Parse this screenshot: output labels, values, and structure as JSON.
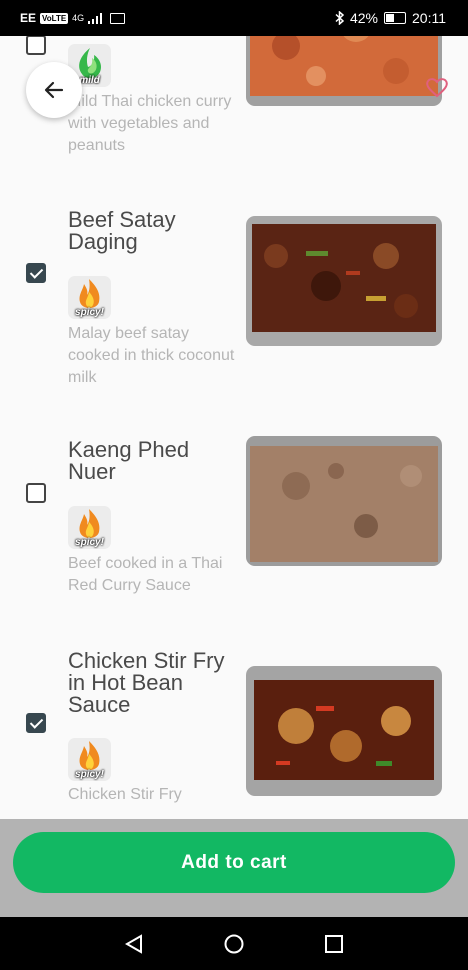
{
  "status_bar": {
    "carrier": "EE",
    "volte": "VoLTE",
    "network": "4G",
    "battery": "42%",
    "time": "20:11",
    "battery_level": 0.42
  },
  "items": [
    {
      "name": "",
      "checked": false,
      "badge_label": "mild",
      "badge_icon": "chili-mild-icon",
      "description": "Mild Thai chicken curry with vegetables and peanuts",
      "favorite": true
    },
    {
      "name": "Beef Satay Daging",
      "checked": true,
      "badge_label": "spicy!",
      "badge_icon": "flame-icon",
      "description": "Malay beef satay cooked in thick coconut milk"
    },
    {
      "name": "Kaeng Phed Nuer",
      "checked": false,
      "badge_label": "spicy!",
      "badge_icon": "flame-icon",
      "description": "Beef cooked in a Thai Red Curry Sauce"
    },
    {
      "name": "Chicken Stir Fry in Hot Bean Sauce",
      "checked": true,
      "badge_label": "spicy!",
      "badge_icon": "flame-icon",
      "description": "Chicken Stir Fry"
    }
  ],
  "add_to_cart_label": "Add to cart",
  "colors": {
    "accent": "#12b863",
    "favorite": "#e0607e",
    "checkbox_checked": "#37474f"
  },
  "icons": {
    "back": "arrow-left-icon",
    "favorite": "heart-outline-icon",
    "nav": [
      "back-triangle-icon",
      "home-circle-icon",
      "recents-square-icon"
    ]
  }
}
